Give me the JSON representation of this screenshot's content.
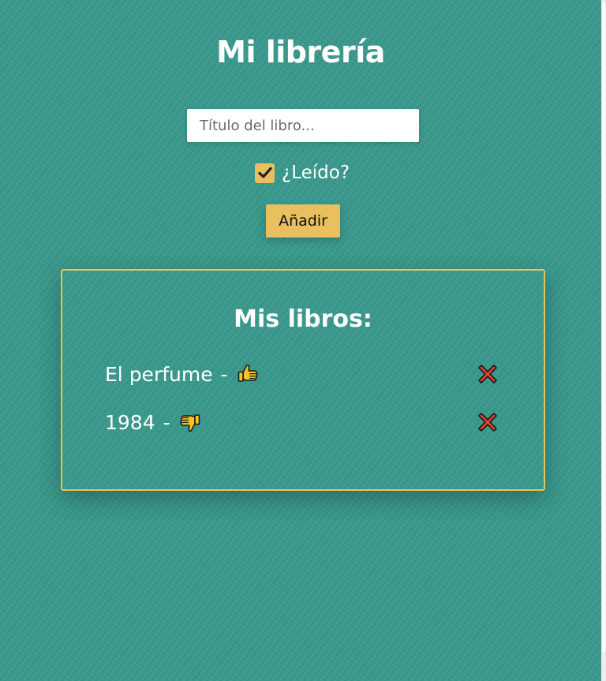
{
  "header": {
    "title": "Mi librería"
  },
  "form": {
    "title_placeholder": "Título del libro...",
    "title_value": "",
    "read_label": "¿Leído?",
    "read_checked": true,
    "add_label": "Añadir"
  },
  "books": {
    "heading": "Mis libros:",
    "separator": "-",
    "items": [
      {
        "title": "El perfume",
        "read": true,
        "icon": "thumbs-up-icon",
        "delete_icon": "cross-mark-icon"
      },
      {
        "title": "1984",
        "read": false,
        "icon": "thumbs-down-icon",
        "delete_icon": "cross-mark-icon"
      }
    ]
  },
  "colors": {
    "background": "#399a8d",
    "accent": "#e8c05f",
    "card_border": "#e3c35f",
    "delete": "#e8432e"
  }
}
